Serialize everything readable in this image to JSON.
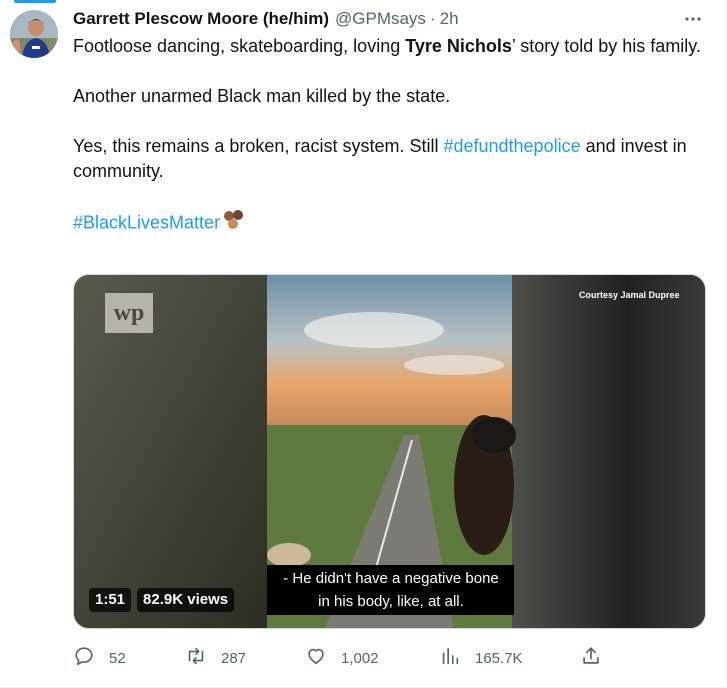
{
  "tweet": {
    "display_name": "Garrett Plescow Moore (he/him)",
    "handle": "@GPMsays",
    "separator": "·",
    "time": "2h",
    "more_label": "•••",
    "body": {
      "p1_a": "Footloose dancing, skateboarding, loving ",
      "p1_bold": "Tyre Nichols",
      "p1_b": "’ story told by his family.",
      "p2": "Another unarmed Black man killed by the state.",
      "p3_a": "Yes, this remains a broken, racist system. Still ",
      "p3_link": "#defundthepolice",
      "p3_b": " and invest in community.",
      "p4_link": "#BlackLivesMatter"
    }
  },
  "media": {
    "duration": "1:51",
    "views": "82.9K views",
    "caption_line1": "- He didn't have a negative bone",
    "caption_line2": "in his body, like, at all.",
    "courtesy": "Courtesy Jamal Dupree",
    "watermark": "wp"
  },
  "actions": {
    "replies": "52",
    "retweets": "287",
    "likes": "1,002",
    "views": "165.7K"
  },
  "colors": {
    "link": "#1d9bf0",
    "muted": "#536471",
    "text": "#0f1419"
  }
}
